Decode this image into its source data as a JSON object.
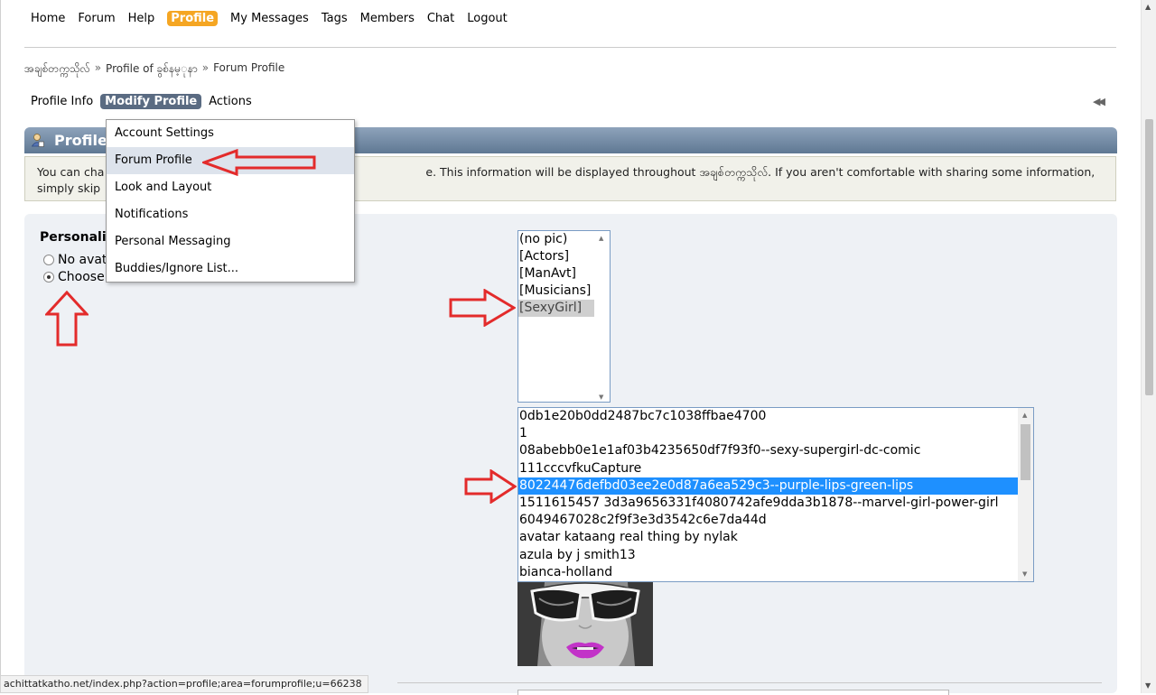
{
  "colors": {
    "accent_orange": "#f5a623",
    "subnav_active": "#5a6b82",
    "category_bar": "#6d85a0",
    "selection_blue": "#1e90ff",
    "annotation_red": "#e32b2b"
  },
  "topnav": {
    "items": [
      "Home",
      "Forum",
      "Help",
      "Profile",
      "My Messages",
      "Tags",
      "Members",
      "Chat",
      "Logout"
    ],
    "active": "Profile"
  },
  "breadcrumb": [
    "အချစ်တက္ကသိုလ်",
    "Profile of ခွစ်နမ့ုနာ",
    "Forum Profile"
  ],
  "breadcrumb_sep": "»",
  "subnav": {
    "items": [
      "Profile Info",
      "Modify Profile",
      "Actions"
    ],
    "active": "Modify Profile",
    "collapse_icon": "double-left-arrow-icon"
  },
  "category": {
    "title": "Profile",
    "icon": "user-profile-icon"
  },
  "description": {
    "line1_start": "You can cha",
    "line1_end": "e. This information will be displayed throughout အချစ်တက္ကသိုလ်. If you aren't comfortable with sharing some information,",
    "line2": "simply skip"
  },
  "dropdown": {
    "items": [
      "Account Settings",
      "Forum Profile",
      "Look and Layout",
      "Notifications",
      "Personal Messaging",
      "Buddies/Ignore List..."
    ],
    "highlighted": "Forum Profile"
  },
  "avatar_section": {
    "title": "Personali",
    "option_none": "No avat",
    "option_choose": "Choose",
    "selected_option": "Choose"
  },
  "avatar_categories": {
    "items": [
      "(no pic)",
      "[Actors]",
      "[ManAvt]",
      "[Musicians]",
      "[SexyGirl]"
    ],
    "selected": "[SexyGirl]"
  },
  "avatar_files": {
    "items": [
      "0db1e20b0dd2487bc7c1038ffbae4700",
      "1",
      "08abebb0e1e1af03b4235650df7f93f0--sexy-supergirl-dc-comic",
      "111cccvfkuCapture",
      "80224476defbd03ee2e0d87a6ea529c3--purple-lips-green-lips",
      "1511615457 3d3a9656331f4080742afe9dda3b1878--marvel-girl-power-girl",
      "6049467028c2f9f3e3d3542c6e7da44d",
      "avatar kataang real thing by nylak",
      "azula by j smith13",
      "bianca-holland"
    ],
    "selected": "80224476defbd03ee2e0d87a6ea529c3--purple-lips-green-lips"
  },
  "statusbar": {
    "url": "achittatkatho.net/index.php?action=profile;area=forumprofile;u=66238"
  }
}
